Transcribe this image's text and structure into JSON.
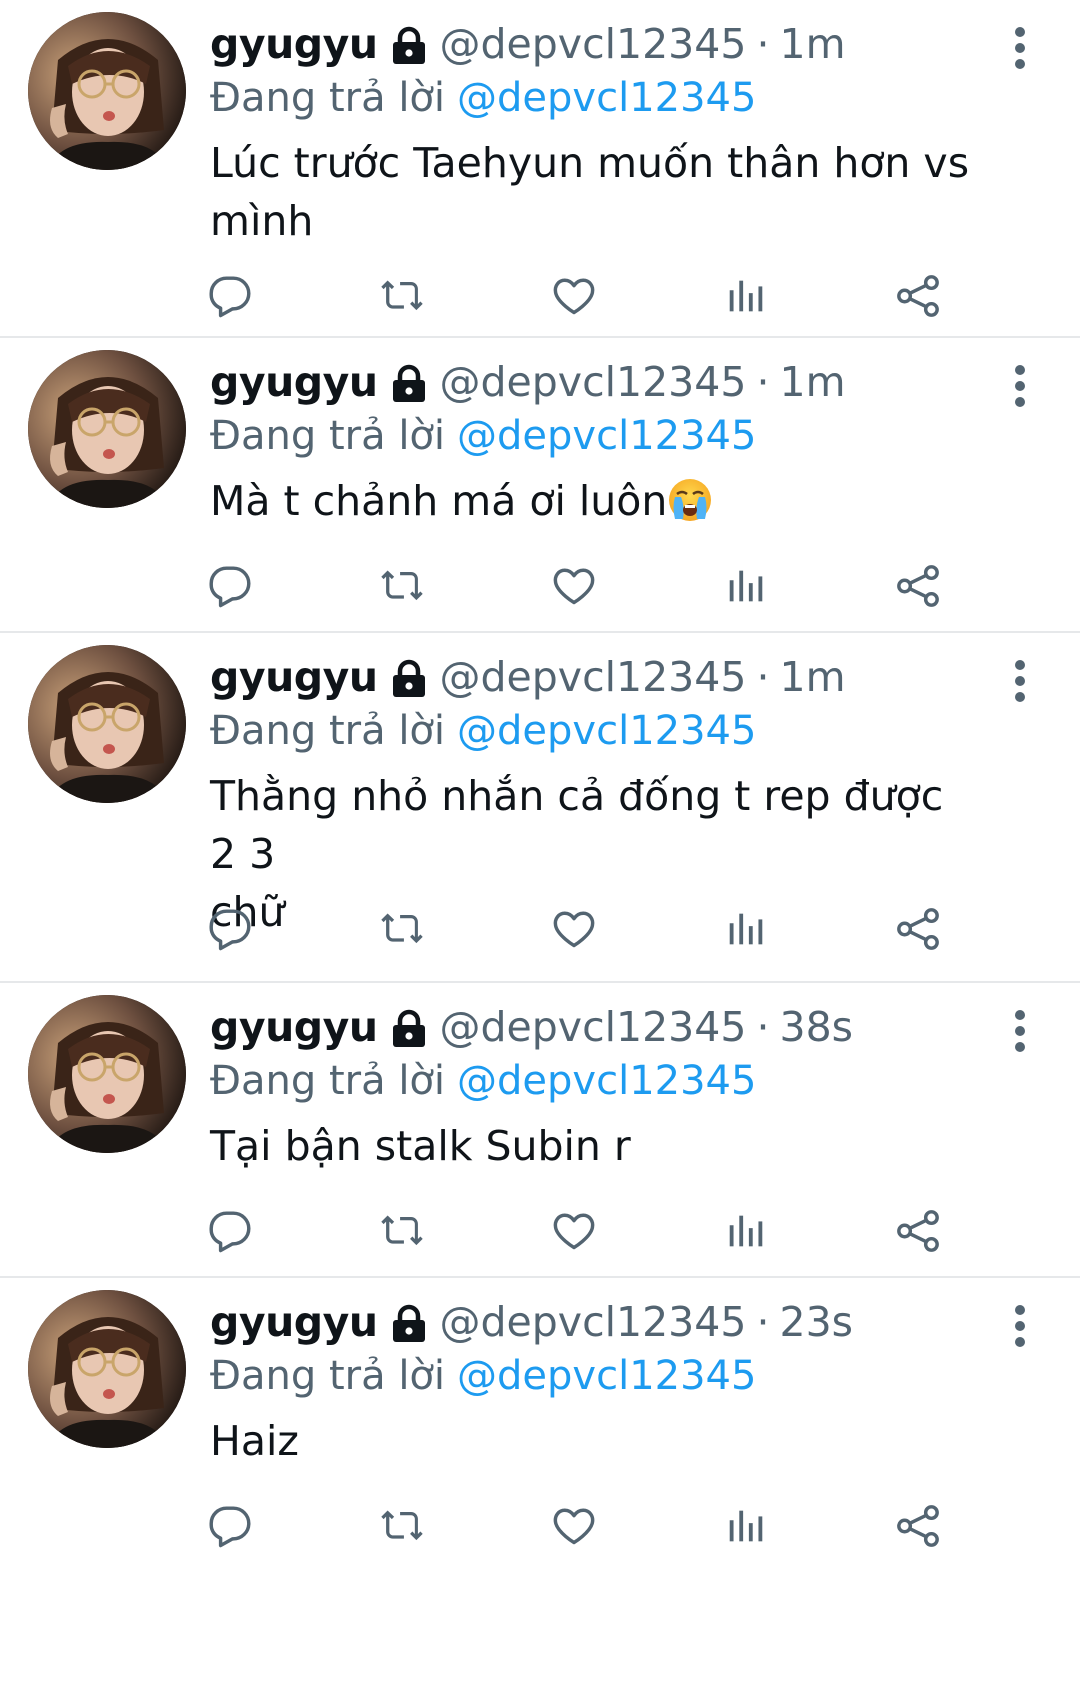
{
  "tweets": [
    {
      "name": "gyugyu",
      "handle": "@depvcl12345",
      "dot": "·",
      "time": "1m",
      "reply_prefix": "Đang trả lời",
      "reply_to": "@depvcl12345",
      "text": "Lúc trước Taehyun muốn thân hơn vs\nmình",
      "emoji": ""
    },
    {
      "name": "gyugyu",
      "handle": "@depvcl12345",
      "dot": "·",
      "time": "1m",
      "reply_prefix": "Đang trả lời",
      "reply_to": "@depvcl12345",
      "text": "Mà t chảnh má ơi luôn",
      "emoji": "loudly-crying-face"
    },
    {
      "name": "gyugyu",
      "handle": "@depvcl12345",
      "dot": "·",
      "time": "1m",
      "reply_prefix": "Đang trả lời",
      "reply_to": "@depvcl12345",
      "text": "Thằng nhỏ nhắn cả đống t rep được 2 3\nchữ",
      "emoji": ""
    },
    {
      "name": "gyugyu",
      "handle": "@depvcl12345",
      "dot": "·",
      "time": "38s",
      "reply_prefix": "Đang trả lời",
      "reply_to": "@depvcl12345",
      "text": "Tại bận stalk Subin r",
      "emoji": ""
    },
    {
      "name": "gyugyu",
      "handle": "@depvcl12345",
      "dot": "·",
      "time": "23s",
      "reply_prefix": "Đang trả lời",
      "reply_to": "@depvcl12345",
      "text": "Haiz",
      "emoji": ""
    }
  ],
  "icons": {
    "lock": "lock-icon",
    "more": "more-vertical-icon",
    "reply": "reply-icon",
    "retweet": "retweet-icon",
    "like": "heart-icon",
    "views": "analytics-icon",
    "share": "share-icon"
  },
  "colors": {
    "text": "#0f1419",
    "muted": "#536471",
    "link": "#1d9bf0",
    "divider": "#e6e8ea"
  }
}
